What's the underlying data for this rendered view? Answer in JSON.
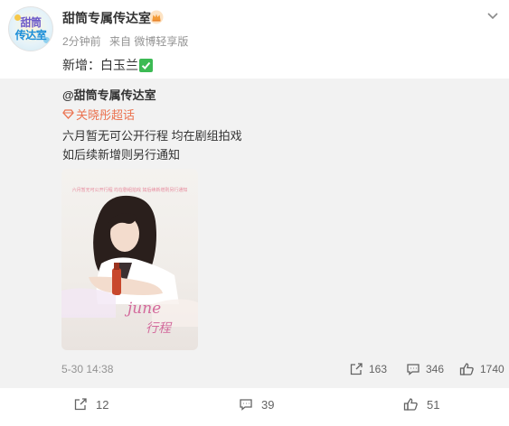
{
  "post": {
    "avatar_text_line1": "甜筒",
    "avatar_text_line2": "传达室",
    "username": "甜筒专属传达室",
    "time_ago": "2分钟前",
    "source": "来自 微博轻享版",
    "content": "新增：白玉兰",
    "icons": {
      "crown": "crown-badge-icon",
      "more": "chevron-down-icon",
      "check": "check-box-icon"
    },
    "colors": {
      "topic": "#eb7350",
      "check": "#3cba54",
      "repost_bg": "#f2f2f2"
    }
  },
  "repost": {
    "author": "@甜筒专属传达室",
    "topic": "关晓彤超话",
    "line1": "六月暂无可公开行程 均在剧组拍戏",
    "line2": "如后续新增则另行通知",
    "image": {
      "caption": "六月暂无可公开行程 均在剧组拍戏 如后续新增则另行通知",
      "script1": "june",
      "script2": "行程"
    },
    "time": "5-30 14:38",
    "reposts": "163",
    "comments": "346",
    "likes": "1740"
  },
  "actions": {
    "repost_count": "12",
    "comment_count": "39",
    "like_count": "51"
  }
}
